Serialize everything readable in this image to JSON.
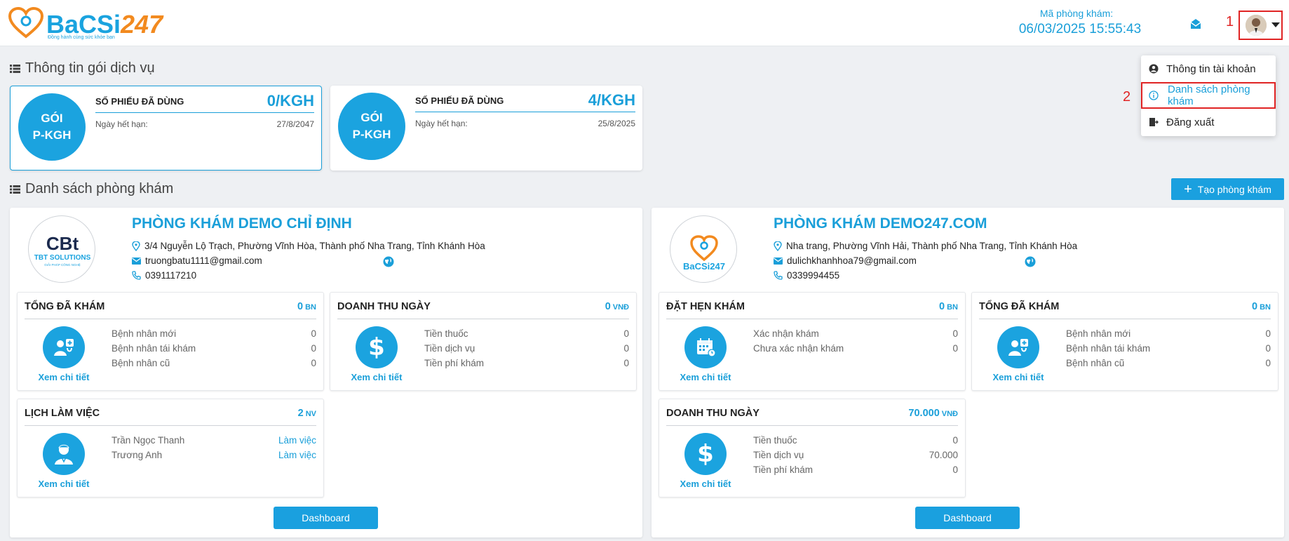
{
  "header": {
    "logo": {
      "word_main": "BaCSi",
      "word_accent": "247",
      "tagline": "Đồng hành cùng sức khỏe bạn"
    },
    "clinic_code_label": "Mã phòng khám:",
    "datetime": "06/03/2025 15:55:43",
    "annotation_1": "1"
  },
  "user_menu": {
    "annotation_2": "2",
    "items": [
      {
        "label": "Thông tin tài khoản",
        "icon": "user-circle-icon"
      },
      {
        "label": "Danh sách phòng khám",
        "icon": "info-icon"
      },
      {
        "label": "Đăng xuất",
        "icon": "logout-icon"
      }
    ]
  },
  "service_section": {
    "title": "Thông tin gói dịch vụ",
    "packages": [
      {
        "circle_line1": "GÓI",
        "circle_line2": "P-KGH",
        "label": "SỐ PHIẾU ĐÃ DÙNG",
        "value": "0/KGH",
        "expiry_label": "Ngày hết hạn:",
        "expiry": "27/8/2047"
      },
      {
        "circle_line1": "GÓI",
        "circle_line2": "P-KGH",
        "label": "SỐ PHIẾU ĐÃ DÙNG",
        "value": "4/KGH",
        "expiry_label": "Ngày hết hạn:",
        "expiry": "25/8/2025"
      }
    ]
  },
  "clinic_section": {
    "title": "Danh sách phòng khám",
    "create_button": "Tạo phòng khám",
    "clinics": [
      {
        "name": "PHÒNG KHÁM DEMO CHỈ ĐỊNH",
        "logo_text": "TBT SOLUTIONS",
        "logo_sub": "GIẢI PHÁP CÔNG NGHỆ",
        "address": "3/4 Nguyễn Lộ Trạch, Phường Vĩnh Hòa, Thành phố Nha Trang, Tỉnh Khánh Hòa",
        "email": "truongbatu1111@gmail.com",
        "phone": "0391117210",
        "stats": [
          {
            "title": "TỔNG ĐÃ KHÁM",
            "total": "0",
            "unit": "BN",
            "link": "Xem chi tiết",
            "rows": [
              {
                "label": "Bệnh nhân mới",
                "value": "0"
              },
              {
                "label": "Bệnh nhân tái khám",
                "value": "0"
              },
              {
                "label": "Bệnh nhân cũ",
                "value": "0"
              }
            ]
          },
          {
            "title": "DOANH THU NGÀY",
            "total": "0",
            "unit": "VNĐ",
            "link": "Xem chi tiết",
            "rows": [
              {
                "label": "Tiền thuốc",
                "value": "0"
              },
              {
                "label": "Tiền dịch vụ",
                "value": "0"
              },
              {
                "label": "Tiền phí khám",
                "value": "0"
              }
            ]
          },
          {
            "title": "LỊCH LÀM VIỆC",
            "total": "2",
            "unit": "NV",
            "link": "Xem chi tiết",
            "rows": [
              {
                "label": "Trần Ngọc Thanh",
                "value": "Làm việc"
              },
              {
                "label": "Trương Anh",
                "value": "Làm việc"
              }
            ]
          }
        ],
        "dashboard_button": "Dashboard"
      },
      {
        "name": "PHÒNG KHÁM DEMO247.COM",
        "logo_text": "BaCSi247",
        "address": "Nha trang, Phường Vĩnh Hải, Thành phố Nha Trang, Tỉnh Khánh Hòa",
        "email": "dulichkhanhhoa79@gmail.com",
        "phone": "0339994455",
        "stats": [
          {
            "title": "ĐẶT HẸN KHÁM",
            "total": "0",
            "unit": "BN",
            "link": "Xem chi tiết",
            "rows": [
              {
                "label": "Xác nhận khám",
                "value": "0"
              },
              {
                "label": "Chưa xác nhận khám",
                "value": "0"
              }
            ]
          },
          {
            "title": "TỔNG ĐÃ KHÁM",
            "total": "0",
            "unit": "BN",
            "link": "Xem chi tiết",
            "rows": [
              {
                "label": "Bệnh nhân mới",
                "value": "0"
              },
              {
                "label": "Bệnh nhân tái khám",
                "value": "0"
              },
              {
                "label": "Bệnh nhân cũ",
                "value": "0"
              }
            ]
          },
          {
            "title": "DOANH THU NGÀY",
            "total": "70.000",
            "unit": "VNĐ",
            "link": "Xem chi tiết",
            "rows": [
              {
                "label": "Tiền thuốc",
                "value": "0"
              },
              {
                "label": "Tiền dịch vụ",
                "value": "70.000"
              },
              {
                "label": "Tiền phí khám",
                "value": "0"
              }
            ]
          }
        ],
        "dashboard_button": "Dashboard"
      }
    ]
  },
  "colors": {
    "accent": "#1a9fd9",
    "brand_orange": "#f28a1f",
    "annotation_red": "#e02424"
  }
}
